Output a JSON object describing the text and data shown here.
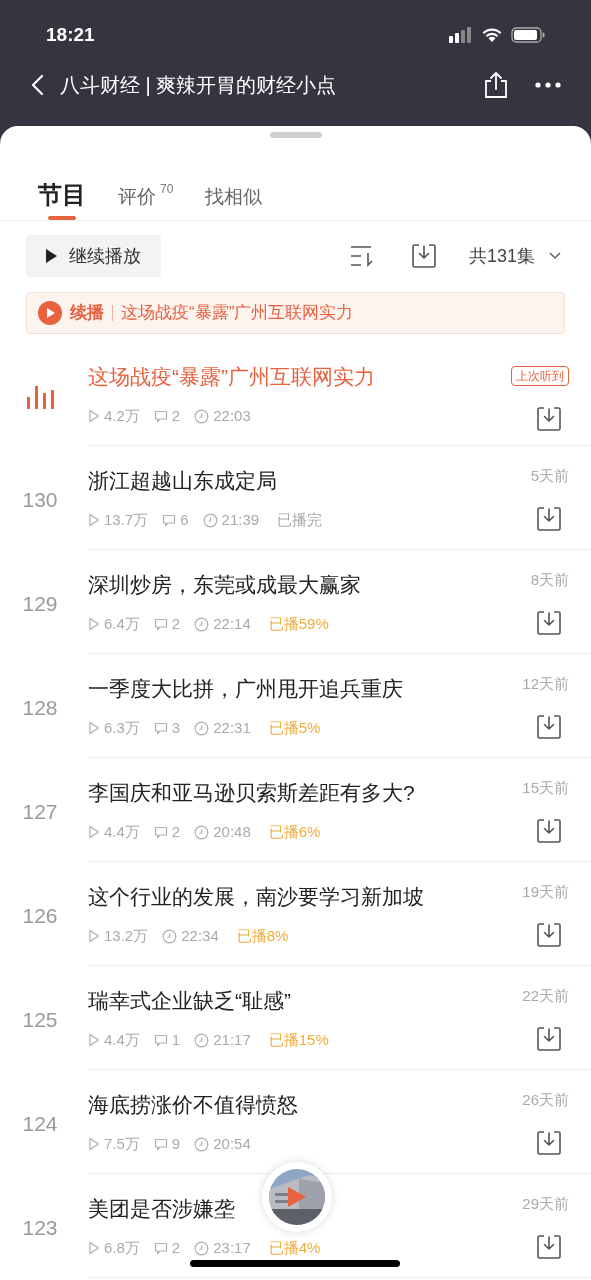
{
  "status_bar": {
    "time": "18:21"
  },
  "nav": {
    "title": "八斗财经 | 爽辣开胃的财经小点"
  },
  "tabs": [
    {
      "label": "节目",
      "selected": true
    },
    {
      "label": "评价",
      "count": "70",
      "selected": false
    },
    {
      "label": "找相似",
      "selected": false
    }
  ],
  "toolbar": {
    "continue_button": "继续播放",
    "episode_count": "共131集"
  },
  "resume_banner": {
    "label": "续播",
    "title": "这场战疫“暴露”广州互联网实力"
  },
  "episodes": [
    {
      "playing": true,
      "title": "这场战疫“暴露”广州互联网实力",
      "badge": "上次听到",
      "plays": "4.2万",
      "comments": "2",
      "duration": "22:03"
    },
    {
      "playing": false,
      "number": "130",
      "title": "浙江超越山东成定局",
      "date": "5天前",
      "plays": "13.7万",
      "comments": "6",
      "duration": "21:39",
      "progress": {
        "kind": "done",
        "text": "已播完"
      }
    },
    {
      "playing": false,
      "number": "129",
      "title": "深圳炒房，东莞或成最大赢家",
      "date": "8天前",
      "plays": "6.4万",
      "comments": "2",
      "duration": "22:14",
      "progress": {
        "kind": "partial",
        "text": "已播59%"
      }
    },
    {
      "playing": false,
      "number": "128",
      "title": "一季度大比拼，广州甩开追兵重庆",
      "date": "12天前",
      "plays": "6.3万",
      "comments": "3",
      "duration": "22:31",
      "progress": {
        "kind": "partial",
        "text": "已播5%"
      }
    },
    {
      "playing": false,
      "number": "127",
      "title": "李国庆和亚马逊贝索斯差距有多大?",
      "date": "15天前",
      "plays": "4.4万",
      "comments": "2",
      "duration": "20:48",
      "progress": {
        "kind": "partial",
        "text": "已播6%"
      }
    },
    {
      "playing": false,
      "number": "126",
      "title": "这个行业的发展，南沙要学习新加坡",
      "date": "19天前",
      "plays": "13.2万",
      "duration": "22:34",
      "progress": {
        "kind": "partial",
        "text": "已播8%"
      }
    },
    {
      "playing": false,
      "number": "125",
      "title": "瑞幸式企业缺乏“耻感”",
      "date": "22天前",
      "plays": "4.4万",
      "comments": "1",
      "duration": "21:17",
      "progress": {
        "kind": "partial",
        "text": "已播15%"
      }
    },
    {
      "playing": false,
      "number": "124",
      "title": "海底捞涨价不值得愤怒",
      "date": "26天前",
      "plays": "7.5万",
      "comments": "9",
      "duration": "20:54"
    },
    {
      "playing": false,
      "number": "123",
      "title": "美团是否涉嫌垄",
      "date": "29天前",
      "plays": "6.8万",
      "comments": "2",
      "duration": "23:17",
      "progress": {
        "kind": "partial",
        "text": "已播4%"
      }
    }
  ]
}
